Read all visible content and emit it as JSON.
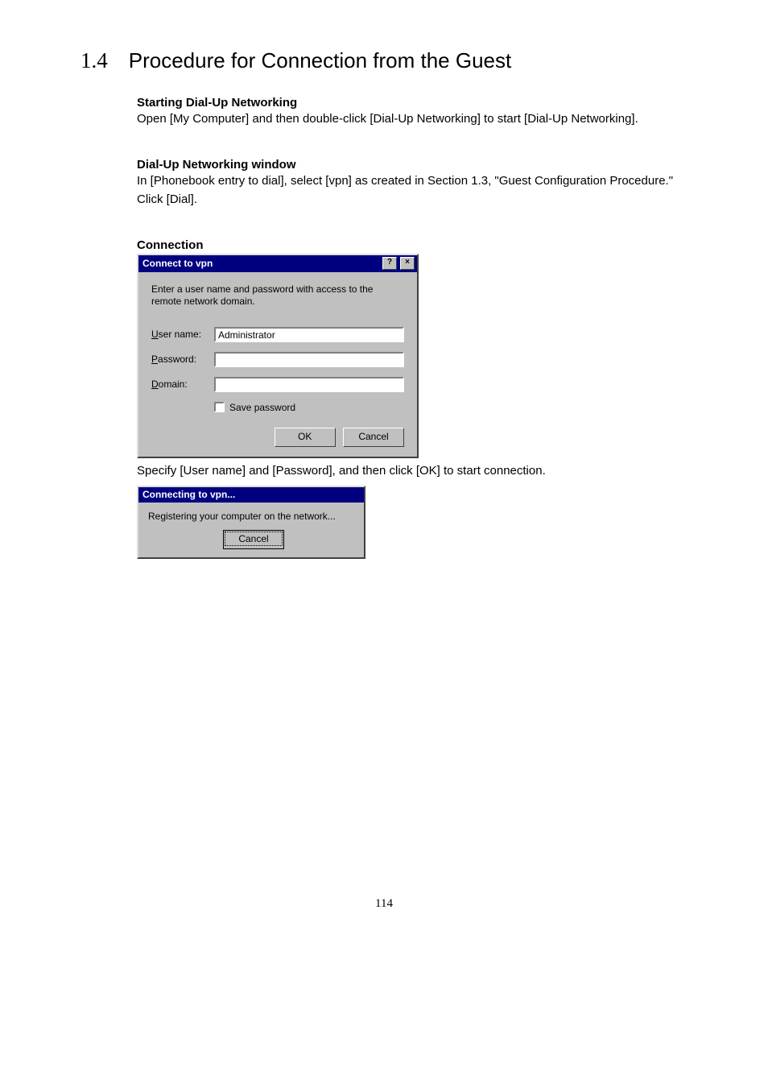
{
  "section": {
    "number": "1.4",
    "title": "Procedure for Connection from the Guest"
  },
  "blocks": {
    "b1_heading": "Starting Dial-Up Networking",
    "b1_text": "Open [My Computer] and then double-click [Dial-Up Networking] to start [Dial-Up Networking].",
    "b2_heading": "Dial-Up Networking window",
    "b2_text1": "In [Phonebook entry to dial], select [vpn] as created in Section 1.3, \"Guest Configuration Procedure.\"",
    "b2_text2": "Click [Dial].",
    "b3_heading": "Connection",
    "b3_after": "Specify [User name] and [Password], and then click [OK] to start connection."
  },
  "dialog1": {
    "title": "Connect to vpn",
    "help_btn": "?",
    "close_btn": "×",
    "instruction": "Enter a user name and password with access to the remote network domain.",
    "labels": {
      "user_pre": "U",
      "user_rest": "ser name:",
      "pass_pre": "P",
      "pass_rest": "assword:",
      "dom_pre": "D",
      "dom_rest": "omain:",
      "save_pre": "S",
      "save_rest": "ave password"
    },
    "values": {
      "user": "Administrator",
      "password": "",
      "domain": ""
    },
    "buttons": {
      "ok": "OK",
      "cancel": "Cancel"
    }
  },
  "dialog2": {
    "title": "Connecting to vpn...",
    "status": "Registering your computer on the network...",
    "cancel": "Cancel"
  },
  "page_number": "114"
}
